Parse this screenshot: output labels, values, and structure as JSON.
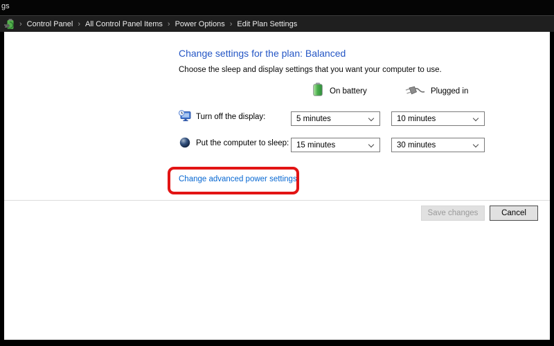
{
  "window": {
    "title_fragment": "gs"
  },
  "breadcrumb": {
    "separator": "›",
    "items": [
      {
        "label": "Control Panel"
      },
      {
        "label": "All Control Panel Items"
      },
      {
        "label": "Power Options"
      },
      {
        "label": "Edit Plan Settings"
      }
    ]
  },
  "page": {
    "title": "Change settings for the plan: Balanced",
    "subtitle": "Choose the sleep and display settings that you want your computer to use."
  },
  "columns": {
    "on_battery": "On battery",
    "plugged_in": "Plugged in"
  },
  "settings": [
    {
      "label": "Turn off the display:",
      "icon": "display-timeout-icon",
      "on_battery_value": "5 minutes",
      "plugged_in_value": "10 minutes"
    },
    {
      "label": "Put the computer to sleep:",
      "icon": "sleep-icon",
      "on_battery_value": "15 minutes",
      "plugged_in_value": "30 minutes"
    }
  ],
  "links": {
    "advanced": "Change advanced power settings"
  },
  "buttons": {
    "save": "Save changes",
    "cancel": "Cancel"
  },
  "colors": {
    "heading": "#2456c5",
    "link": "#0667d2",
    "annotation": "#e21414",
    "bar": "#1f1f1f"
  }
}
